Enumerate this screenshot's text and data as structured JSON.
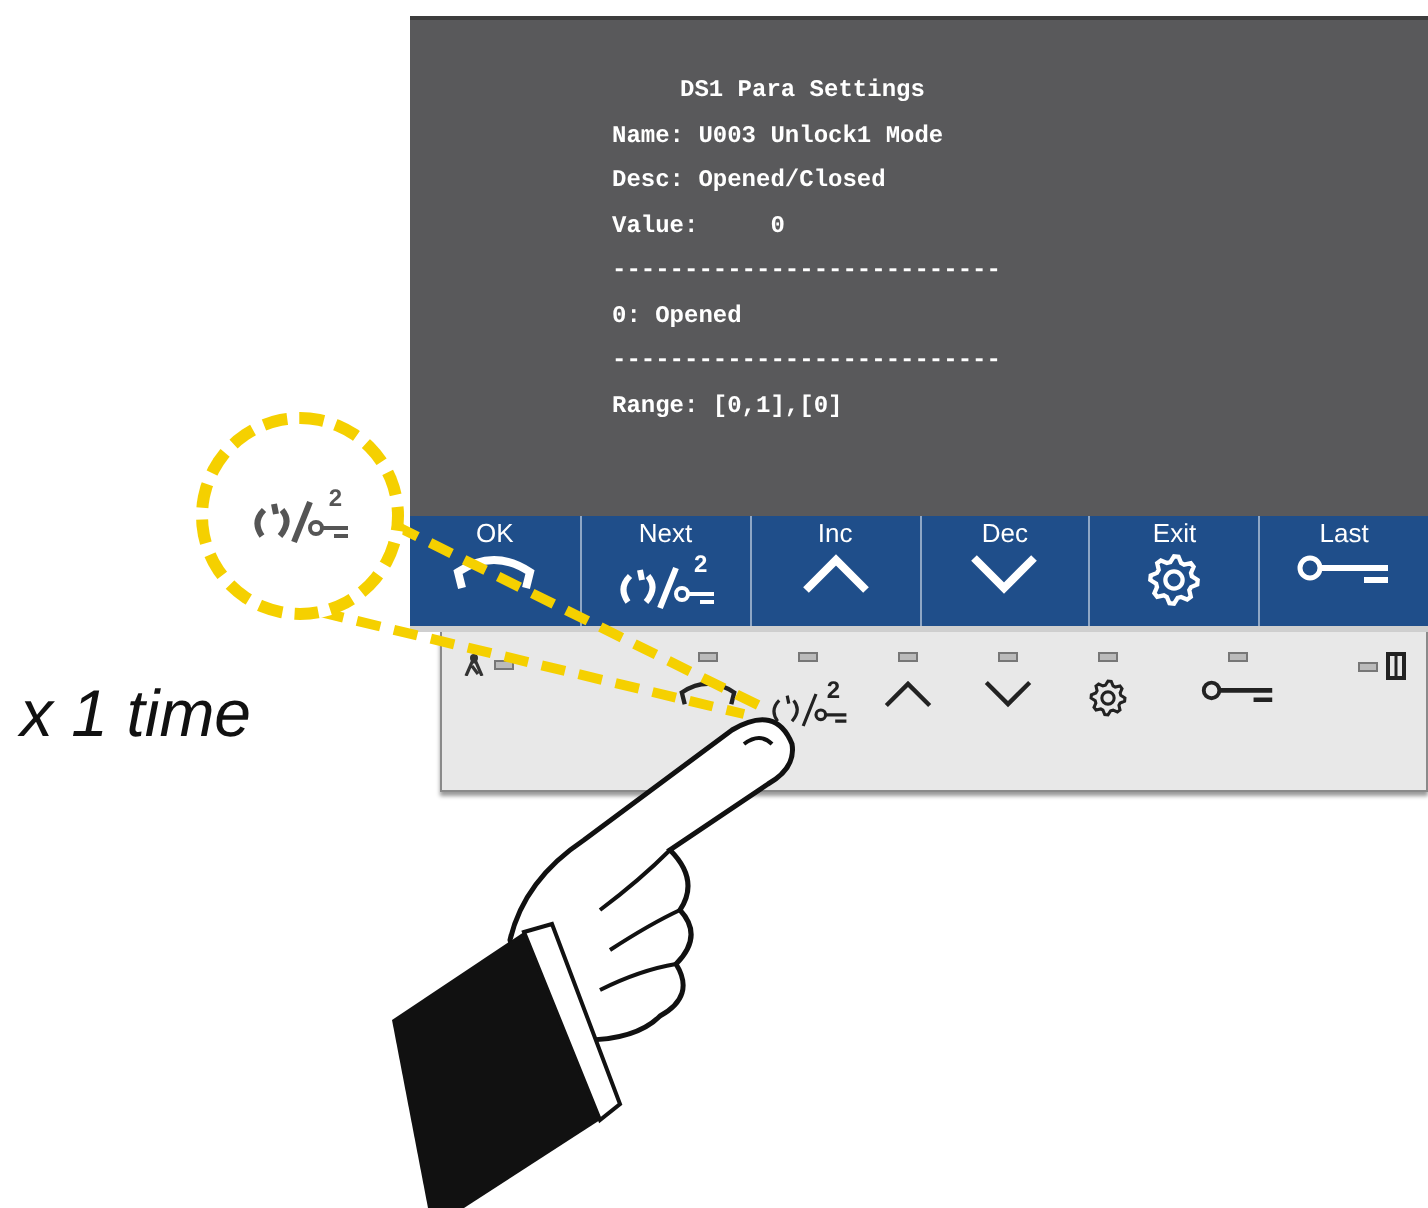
{
  "instruction": "x 1 time",
  "callout": {
    "digit": "2"
  },
  "screen": {
    "title": "DS1 Para Settings",
    "lines": [
      {
        "text": "Name: U003 Unlock1 Mode"
      },
      {
        "text": "Desc: Opened/Closed"
      },
      {
        "text": "Value:     0"
      },
      {
        "text": "---------------------------"
      },
      {
        "text": "0: Opened"
      },
      {
        "text": "---------------------------"
      },
      {
        "text": "Range: [0,1],[0]"
      }
    ]
  },
  "soft_keys": [
    {
      "label": "OK",
      "kind": "ok"
    },
    {
      "label": "Next",
      "kind": "next",
      "digit": "2"
    },
    {
      "label": "Inc",
      "kind": "up"
    },
    {
      "label": "Dec",
      "kind": "down"
    },
    {
      "label": "Exit",
      "kind": "gear"
    },
    {
      "label": "Last",
      "kind": "key"
    }
  ],
  "keypad": {
    "keys": [
      {
        "kind": "ok"
      },
      {
        "kind": "next",
        "digit": "2"
      },
      {
        "kind": "up"
      },
      {
        "kind": "down"
      },
      {
        "kind": "gear"
      },
      {
        "kind": "key"
      }
    ]
  }
}
